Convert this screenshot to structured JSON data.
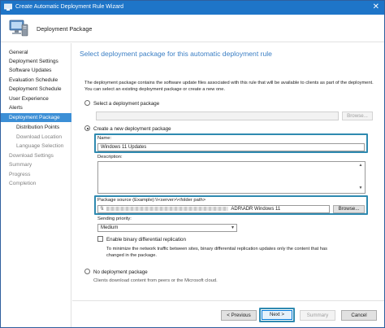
{
  "window": {
    "title": "Create Automatic Deployment Rule Wizard",
    "close_glyph": "✕"
  },
  "header": {
    "title": "Deployment Package"
  },
  "sidebar": {
    "items": [
      {
        "label": "General"
      },
      {
        "label": "Deployment Settings"
      },
      {
        "label": "Software Updates"
      },
      {
        "label": "Evaluation Schedule"
      },
      {
        "label": "Deployment Schedule"
      },
      {
        "label": "User Experience"
      },
      {
        "label": "Alerts"
      },
      {
        "label": "Deployment Package"
      },
      {
        "label": "Distribution Points"
      },
      {
        "label": "Download Location"
      },
      {
        "label": "Language Selection"
      },
      {
        "label": "Download Settings"
      },
      {
        "label": "Summary"
      },
      {
        "label": "Progress"
      },
      {
        "label": "Completion"
      }
    ]
  },
  "main": {
    "heading": "Select deployment package for this automatic deployment rule",
    "description": "The deployment package contains the software update files associated with this rule that will be available to clients as part of the deployment. You can select an existing deployment package or create a new one.",
    "select_existing": {
      "label": "Select a deployment package",
      "value": "",
      "browse": "Browse..."
    },
    "create_new": {
      "label": "Create a new deployment package",
      "name_label": "Name:",
      "name_value": "Windows 11 Updates",
      "description_label": "Description:",
      "description_value": "",
      "source_label": "Package source (Example):\\\\<server>\\<folder path>",
      "source_prefix": "\\\\",
      "source_value": "ADR\\ADR Windows 11",
      "browse": "Browse...",
      "priority_label": "Sending priority:",
      "priority_value": "Medium",
      "binary_label": "Enable binary differential replication",
      "binary_note": "To minimize the network traffic between sites, binary differential replication updates only the content that has changed in the package."
    },
    "no_package": {
      "label": "No deployment package",
      "note": "Clients download content from peers or the Microsoft cloud."
    }
  },
  "footer": {
    "previous": "< Previous",
    "next": "Next >",
    "summary": "Summary",
    "cancel": "Cancel"
  },
  "colors": {
    "titlebar": "#1e75c8",
    "accent_heading": "#3a7ec4",
    "nav_active": "#3c8fd6",
    "highlight": "#2f8ab0"
  }
}
